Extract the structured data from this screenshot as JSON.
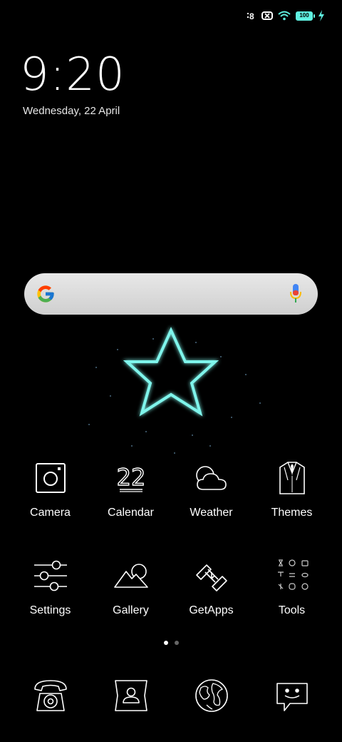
{
  "status": {
    "battery_level": "100",
    "colors": {
      "accent": "#5ff0e0"
    }
  },
  "lockscreen": {
    "time": "9:20",
    "date": "Wednesday, 22 April"
  },
  "search_bar": {
    "google_icon": "google-g-icon",
    "mic_icon": "microphone-icon"
  },
  "apps": [
    {
      "label": "Camera",
      "icon": "camera-icon"
    },
    {
      "label": "Calendar",
      "icon": "calendar-icon"
    },
    {
      "label": "Weather",
      "icon": "weather-icon"
    },
    {
      "label": "Themes",
      "icon": "themes-icon"
    },
    {
      "label": "Settings",
      "icon": "settings-icon"
    },
    {
      "label": "Gallery",
      "icon": "gallery-icon"
    },
    {
      "label": "GetApps",
      "icon": "getapps-icon"
    },
    {
      "label": "Tools",
      "icon": "tools-folder-icon"
    }
  ],
  "calendar_day": "22",
  "pages": {
    "current": 1,
    "total": 2
  },
  "dock": [
    {
      "icon": "phone-icon"
    },
    {
      "icon": "contacts-icon"
    },
    {
      "icon": "browser-icon"
    },
    {
      "icon": "messages-icon"
    }
  ]
}
